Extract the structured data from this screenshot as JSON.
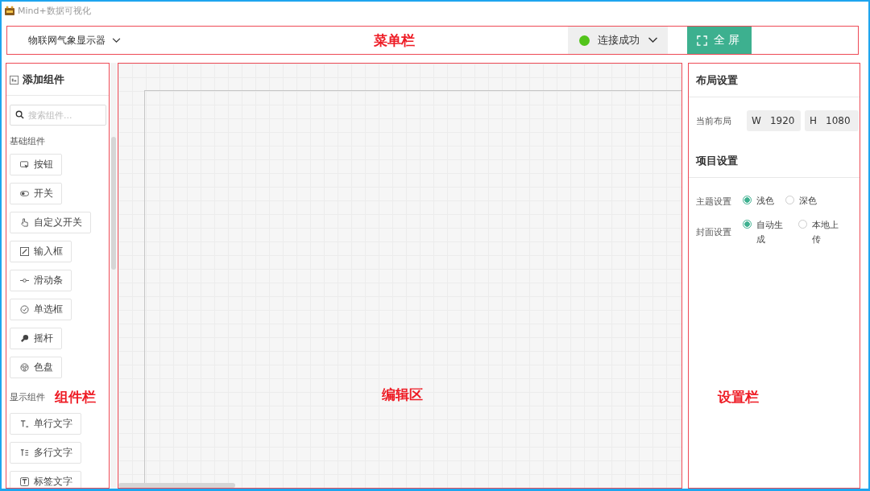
{
  "window": {
    "title": "Mind+数据可视化"
  },
  "menu_bar": {
    "project": "物联网气象显示器",
    "connection": {
      "label": "连接成功",
      "connected": true
    },
    "fullscreen_button": "全 屏",
    "annotation": "菜单栏"
  },
  "component_panel": {
    "title": "添加组件",
    "search": {
      "placeholder": "搜索组件..."
    },
    "annotation": "组件栏",
    "groups": [
      {
        "label": "基础组件",
        "items": [
          "按钮",
          "开关",
          "自定义开关",
          "输入框",
          "滑动条",
          "单选框",
          "摇杆",
          "色盘"
        ]
      },
      {
        "label": "显示组件",
        "items": [
          "单行文字",
          "多行文字",
          "标签文字"
        ]
      }
    ]
  },
  "editor": {
    "annotation": "编辑区"
  },
  "settings_panel": {
    "layout_heading": "布局设置",
    "layout_label": "当前布局",
    "width": {
      "prefix": "W",
      "value": "1920"
    },
    "height": {
      "prefix": "H",
      "value": "1080"
    },
    "project_heading": "项目设置",
    "annotation": "设置栏",
    "options": [
      {
        "label": "主题设置",
        "choices": [
          {
            "label": "浅色",
            "selected": true
          },
          {
            "label": "深色",
            "selected": false
          }
        ]
      },
      {
        "label": "封面设置",
        "choices": [
          {
            "label": "自动生成",
            "selected": true
          },
          {
            "label": "本地上传",
            "selected": false
          }
        ]
      }
    ]
  }
}
